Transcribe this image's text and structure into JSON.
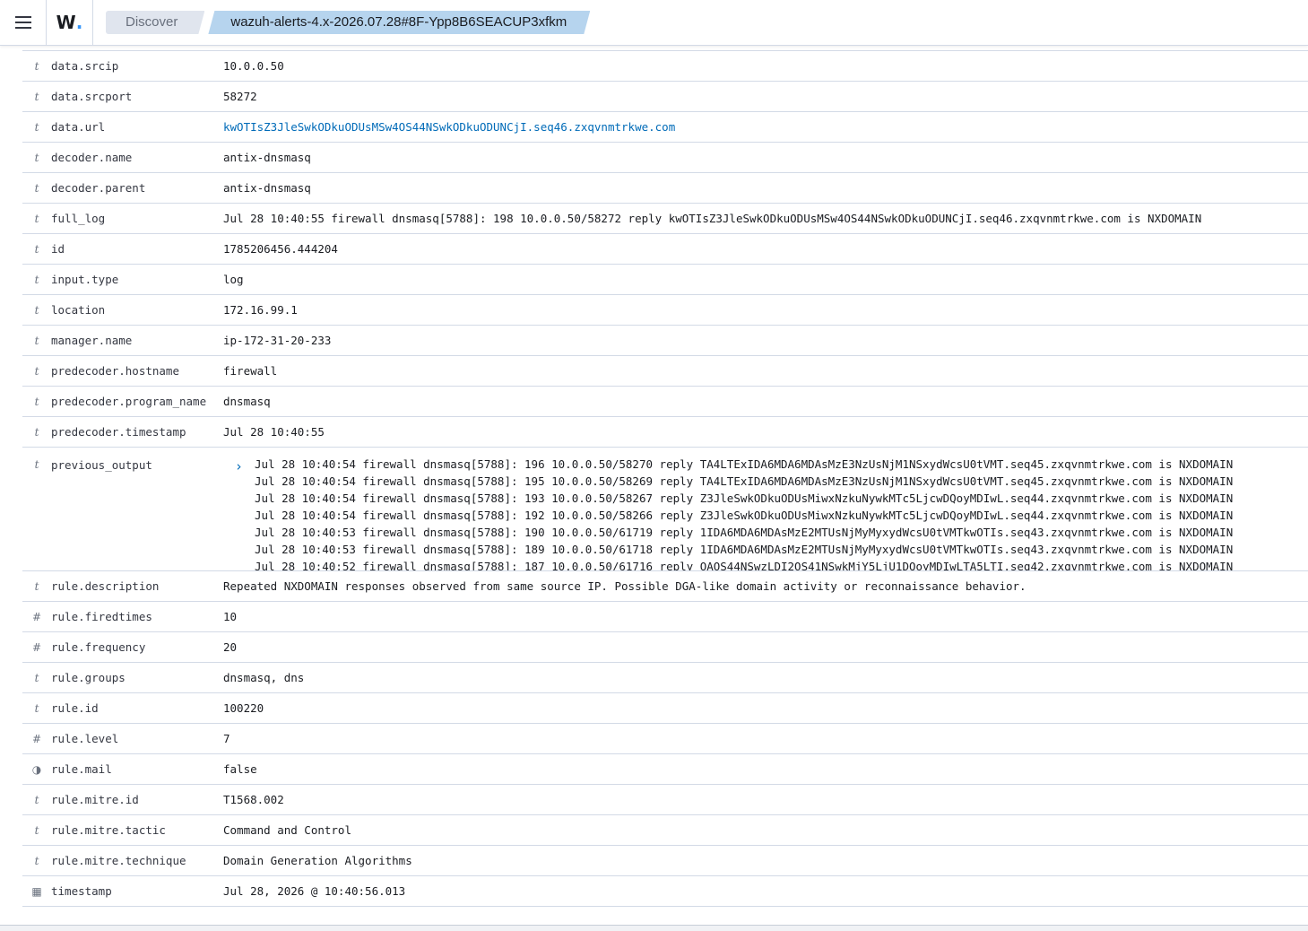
{
  "header": {
    "menu_icon": "hamburger-menu-icon",
    "logo_text": "W",
    "logo_dot": ".",
    "breadcrumbs": [
      "Discover",
      "wazuh-alerts-4.x-2026.07.28#8F-Ypp8B6SEACUP3xfkm"
    ]
  },
  "fields": [
    {
      "type": "t",
      "name": "data.srcip",
      "value": "10.0.0.50"
    },
    {
      "type": "t",
      "name": "data.srcport",
      "value": "58272"
    },
    {
      "type": "t",
      "name": "data.url",
      "value": "kwOTIsZ3JleSwkODkuODUsMSw4OS44NSwkODkuODUNCjI.seq46.zxqvnmtrkwe.com"
    },
    {
      "type": "t",
      "name": "decoder.name",
      "value": "antix-dnsmasq"
    },
    {
      "type": "t",
      "name": "decoder.parent",
      "value": "antix-dnsmasq"
    },
    {
      "type": "t",
      "name": "full_log",
      "value": "Jul 28 10:40:55 firewall dnsmasq[5788]: 198 10.0.0.50/58272 reply kwOTIsZ3JleSwkODkuODUsMSw4OS44NSwkODkuODUNCjI.seq46.zxqvnmtrkwe.com is NXDOMAIN"
    },
    {
      "type": "t",
      "name": "id",
      "value": "1785206456.444204"
    },
    {
      "type": "t",
      "name": "input.type",
      "value": "log"
    },
    {
      "type": "t",
      "name": "location",
      "value": "172.16.99.1"
    },
    {
      "type": "t",
      "name": "manager.name",
      "value": "ip-172-31-20-233"
    },
    {
      "type": "t",
      "name": "predecoder.hostname",
      "value": "firewall"
    },
    {
      "type": "t",
      "name": "predecoder.program_name",
      "value": "dnsmasq"
    },
    {
      "type": "t",
      "name": "predecoder.timestamp",
      "value": "Jul 28 10:40:55"
    }
  ],
  "previous_output": {
    "type": "t",
    "name": "previous_output",
    "lines": [
      "Jul 28 10:40:54 firewall dnsmasq[5788]: 196 10.0.0.50/58270 reply TA4LTExIDA6MDA6MDAsMzE3NzUsNjM1NSxydWcsU0tVMT.seq45.zxqvnmtrkwe.com is NXDOMAIN",
      "Jul 28 10:40:54 firewall dnsmasq[5788]: 195 10.0.0.50/58269 reply TA4LTExIDA6MDA6MDAsMzE3NzUsNjM1NSxydWcsU0tVMT.seq45.zxqvnmtrkwe.com is NXDOMAIN",
      "Jul 28 10:40:54 firewall dnsmasq[5788]: 193 10.0.0.50/58267 reply Z3JleSwkODkuODUsMiwxNzkuNywkMTc5LjcwDQoyMDIwL.seq44.zxqvnmtrkwe.com is NXDOMAIN",
      "Jul 28 10:40:54 firewall dnsmasq[5788]: 192 10.0.0.50/58266 reply Z3JleSwkODkuODUsMiwxNzkuNywkMTc5LjcwDQoyMDIwL.seq44.zxqvnmtrkwe.com is NXDOMAIN",
      "Jul 28 10:40:53 firewall dnsmasq[5788]: 190 10.0.0.50/61719 reply 1IDA6MDA6MDAsMzE2MTUsNjMyMyxydWcsU0tVMTkwOTIs.seq43.zxqvnmtrkwe.com is NXDOMAIN",
      "Jul 28 10:40:53 firewall dnsmasq[5788]: 189 10.0.0.50/61718 reply 1IDA6MDA6MDAsMzE2MTUsNjMyMyxydWcsU0tVMTkwOTIs.seq43.zxqvnmtrkwe.com is NXDOMAIN",
      "Jul 28 10:40:52 firewall dnsmasq[5788]: 187 10.0.0.50/61716 reply OAOS44NSwzLDI2OS41NSwkMjY5LjU1DQoyMDIwLTA5LTI.seq42.zxqvnmtrkwe.com is NXDOMAIN"
    ]
  },
  "fields2": [
    {
      "type": "t",
      "name": "rule.description",
      "value": "Repeated NXDOMAIN responses observed from same source IP. Possible DGA-like domain activity or reconnaissance behavior."
    },
    {
      "type": "#",
      "name": "rule.firedtimes",
      "value": "10"
    },
    {
      "type": "#",
      "name": "rule.frequency",
      "value": "20"
    },
    {
      "type": "t",
      "name": "rule.groups",
      "value": "dnsmasq, dns"
    },
    {
      "type": "t",
      "name": "rule.id",
      "value": "100220"
    },
    {
      "type": "#",
      "name": "rule.level",
      "value": "7"
    },
    {
      "type": "◑",
      "name": "rule.mail",
      "value": "false"
    },
    {
      "type": "t",
      "name": "rule.mitre.id",
      "value": "T1568.002"
    },
    {
      "type": "t",
      "name": "rule.mitre.tactic",
      "value": "Command and Control"
    },
    {
      "type": "t",
      "name": "rule.mitre.technique",
      "value": "Domain Generation Algorithms"
    },
    {
      "type": "▦",
      "name": "timestamp",
      "value": "Jul 28, 2026 @ 10:40:56.013"
    }
  ]
}
